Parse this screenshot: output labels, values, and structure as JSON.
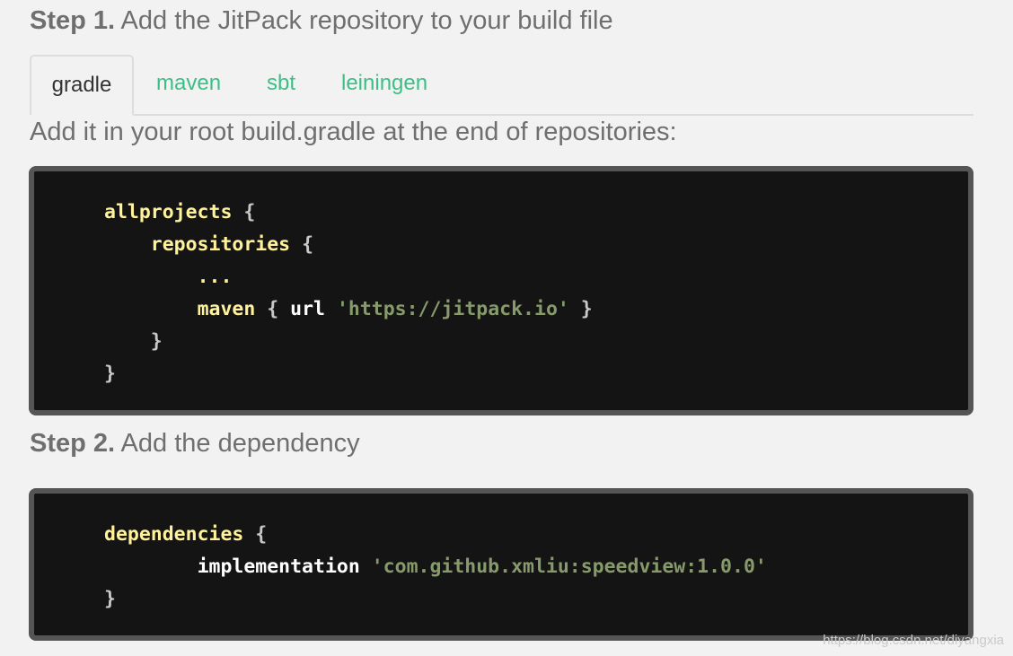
{
  "step1": {
    "label": "Step 1.",
    "text": " Add the JitPack repository to your build file"
  },
  "tabs": [
    {
      "label": "gradle",
      "active": true
    },
    {
      "label": "maven",
      "active": false
    },
    {
      "label": "sbt",
      "active": false
    },
    {
      "label": "leiningen",
      "active": false
    }
  ],
  "hint": "Add it in your root build.gradle at the end of repositories:",
  "code1": {
    "allprojects": "allprojects",
    "repositories": "repositories",
    "dots": "...",
    "maven": "maven",
    "url": "url",
    "url_value": "'https://jitpack.io'",
    "open": "{",
    "close": "}"
  },
  "step2": {
    "label": "Step 2.",
    "text": " Add the dependency"
  },
  "code2": {
    "dependencies": "dependencies",
    "implementation": "implementation",
    "artifact": "'com.github.xmliu:speedview:1.0.0'",
    "open": "{",
    "close": "}"
  },
  "watermark": "https://blog.csdn.net/diyangxia",
  "colors": {
    "tab_link": "#3cbf87",
    "code_bg": "#141414",
    "code_border": "#555555",
    "keyword": "#fff29b",
    "string": "#879a6b"
  }
}
